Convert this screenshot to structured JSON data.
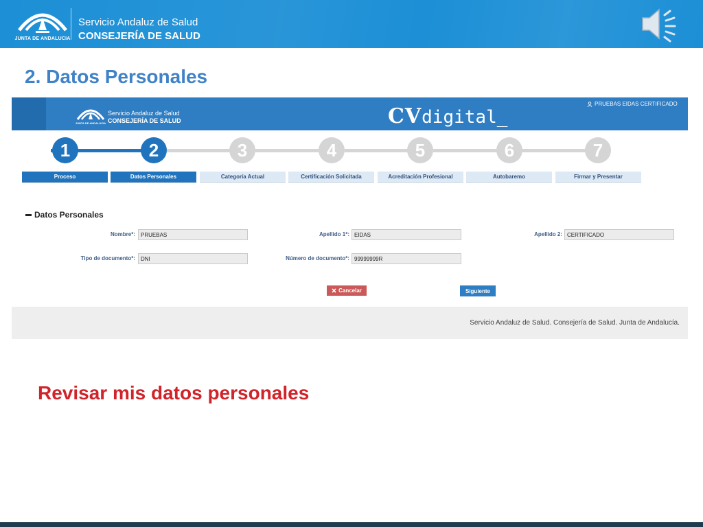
{
  "banner": {
    "logo_text": "JUNTA DE ANDALUCIA",
    "line1": "Servicio Andaluz de Salud",
    "line2": "CONSEJERÍA DE SALUD",
    "speaker_icon": "speaker-icon"
  },
  "slide_title": "2. Datos Personales",
  "app": {
    "header": {
      "logo_small": "JUNTA DE ANDALUCIA",
      "logo_line1": "Servicio Andaluz de Salud",
      "logo_line2": "CONSEJERÍA DE SALUD",
      "brand_cv": "CV",
      "brand_digital": "digital_",
      "user_icon": "user-icon",
      "user_name": "PRUEBAS EIDAS CERTIFICADO"
    },
    "steps": [
      {
        "number": "1",
        "label": "Proceso",
        "done": true
      },
      {
        "number": "2",
        "label": "Datos Personales",
        "done": true
      },
      {
        "number": "3",
        "label": "Categoría Actual",
        "done": false
      },
      {
        "number": "4",
        "label": "Certificación Solicitada",
        "done": false
      },
      {
        "number": "5",
        "label": "Acreditación Profesional",
        "done": false
      },
      {
        "number": "6",
        "label": "Autobaremo",
        "done": false
      },
      {
        "number": "7",
        "label": "Firmar y Presentar",
        "done": false
      }
    ],
    "section_title": "Datos Personales",
    "form": {
      "nombre_label": "Nombre*:",
      "nombre_value": "PRUEBAS",
      "apellido1_label": "Apellido 1*:",
      "apellido1_value": "EIDAS",
      "apellido2_label": "Apellido 2:",
      "apellido2_value": "CERTIFICADO",
      "tipo_doc_label": "Tipo de documento*:",
      "tipo_doc_value": "DNI",
      "num_doc_label": "Número de documento*:",
      "num_doc_value": "99999999R"
    },
    "buttons": {
      "cancel_label": "Cancelar",
      "cancel_icon": "close-icon",
      "next_label": "Siguiente"
    },
    "footer_text": "Servicio Andaluz de Salud. Consejería de Salud. Junta de Andalucía."
  },
  "subtitle": "Revisar mis datos personales",
  "colors": {
    "banner_blue": "#1c8fd6",
    "header_blue": "#2f7dc2",
    "step_done": "#1f74bd",
    "step_pending": "#d5d5d5",
    "title_blue": "#3f82c7",
    "subtitle_red": "#d1232a",
    "cancel_red": "#cc5959"
  }
}
